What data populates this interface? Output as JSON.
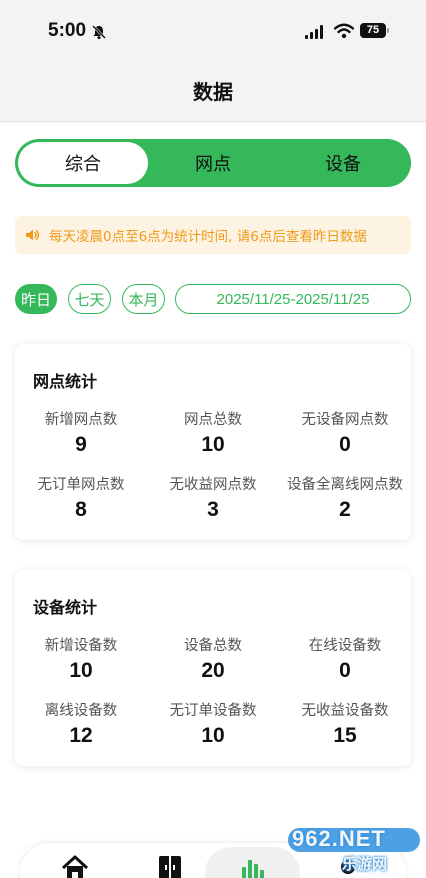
{
  "status": {
    "time": "5:00",
    "battery": "75"
  },
  "header": {
    "title": "数据"
  },
  "tabs": [
    {
      "label": "综合",
      "active": true
    },
    {
      "label": "网点",
      "active": false
    },
    {
      "label": "设备",
      "active": false
    }
  ],
  "notice": {
    "text": "每天凌晨0点至6点为统计时间, 请6点后查看昨日数据"
  },
  "range": {
    "today": "昨日",
    "week": "七天",
    "month": "本月",
    "date_range": "2025/11/25-2025/11/25"
  },
  "outlet_stats": {
    "title": "网点统计",
    "rows": [
      [
        {
          "label": "新增网点数",
          "value": "9"
        },
        {
          "label": "网点总数",
          "value": "10"
        },
        {
          "label": "无设备网点数",
          "value": "0"
        }
      ],
      [
        {
          "label": "无订单网点数",
          "value": "8"
        },
        {
          "label": "无收益网点数",
          "value": "3"
        },
        {
          "label": "设备全离线网点数",
          "value": "2"
        }
      ]
    ]
  },
  "device_stats": {
    "title": "设备统计",
    "rows": [
      [
        {
          "label": "新增设备数",
          "value": "10"
        },
        {
          "label": "设备总数",
          "value": "20"
        },
        {
          "label": "在线设备数",
          "value": "0"
        }
      ],
      [
        {
          "label": "离线设备数",
          "value": "12"
        },
        {
          "label": "无订单设备数",
          "value": "10"
        },
        {
          "label": "无收益设备数",
          "value": "15"
        }
      ]
    ]
  },
  "watermark": {
    "top": "962.NET",
    "bottom": "乐游网"
  },
  "colors": {
    "accent": "#34b85a",
    "notice_bg": "#fdf3e2",
    "notice_text": "#f09a1a"
  },
  "icons": [
    "bell-slash-icon",
    "signal-icon",
    "wifi-icon",
    "speaker-icon",
    "home-icon",
    "door-icon",
    "bar-chart-icon",
    "user-icon"
  ]
}
